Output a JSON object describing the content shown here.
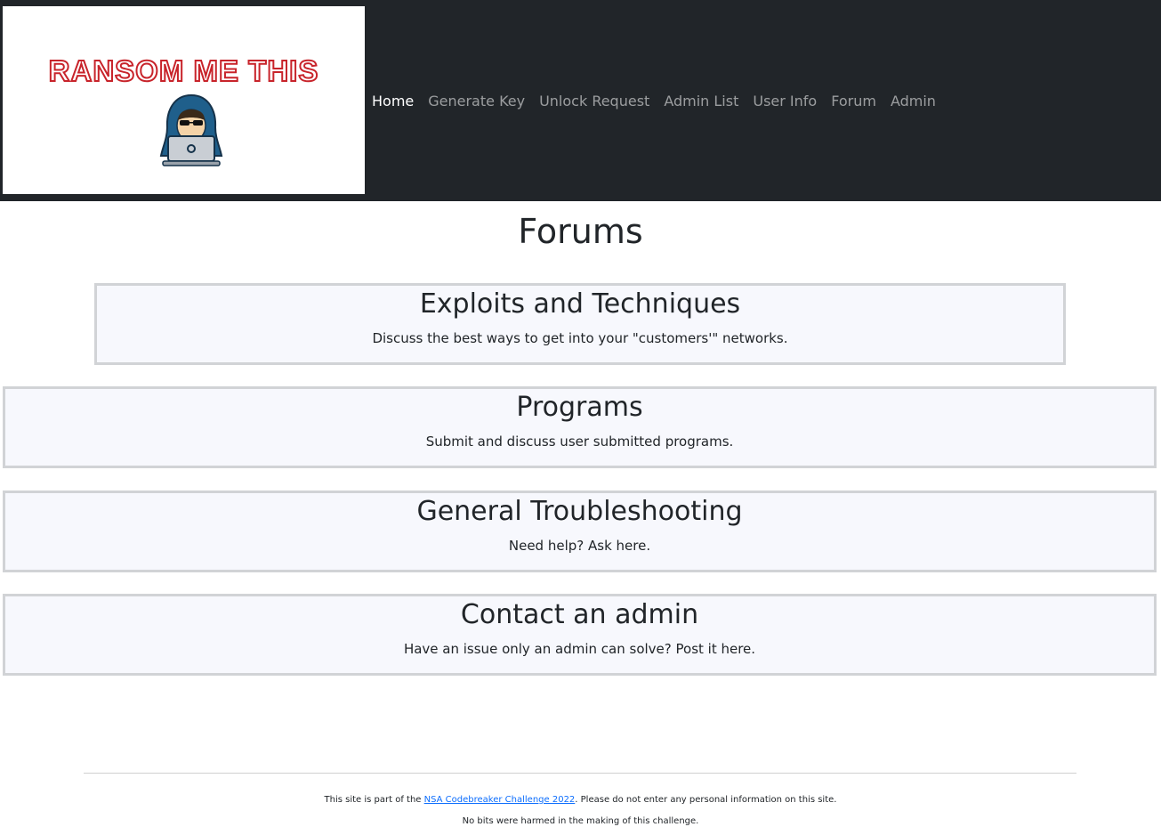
{
  "logo": {
    "text": "RANSOM ME THIS",
    "icon": "hacker-laptop-icon",
    "brand_color": "#c8242b"
  },
  "nav": {
    "items": [
      {
        "label": "Home",
        "active": true
      },
      {
        "label": "Generate Key",
        "active": false
      },
      {
        "label": "Unlock Request",
        "active": false
      },
      {
        "label": "Admin List",
        "active": false
      },
      {
        "label": "User Info",
        "active": false
      },
      {
        "label": "Forum",
        "active": false
      },
      {
        "label": "Admin",
        "active": false
      }
    ]
  },
  "main": {
    "title": "Forums",
    "forums": [
      {
        "title": "Exploits and Techniques",
        "description": "Discuss the best ways to get into your \"customers'\" networks."
      },
      {
        "title": "Programs",
        "description": "Submit and discuss user submitted programs."
      },
      {
        "title": "General Troubleshooting",
        "description": "Need help? Ask here."
      },
      {
        "title": "Contact an admin",
        "description": "Have an issue only an admin can solve? Post it here."
      }
    ]
  },
  "footer": {
    "line1_prefix": "This site is part of the ",
    "line1_link": "NSA Codebreaker Challenge 2022",
    "line1_suffix": ". Please do not enter any personal information on this site.",
    "line2": "No bits were harmed in the making of this challenge."
  },
  "colors": {
    "navbar_bg": "#212529",
    "card_bg": "#f7f8fd",
    "card_border": "#d1d3d6",
    "link": "#0d6efd"
  }
}
